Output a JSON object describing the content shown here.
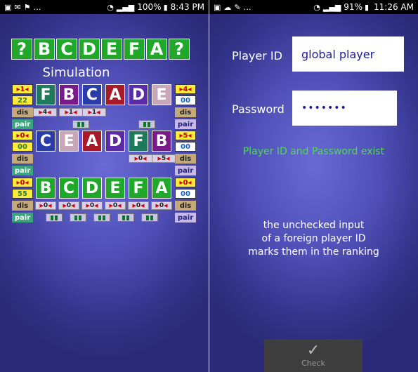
{
  "left": {
    "status": {
      "time": "8:43 PM",
      "battery": "100%"
    },
    "title_tiles": [
      {
        "ch": "?",
        "color": "#1fa82a"
      },
      {
        "ch": "B",
        "color": "#1fa82a"
      },
      {
        "ch": "C",
        "color": "#1fa82a"
      },
      {
        "ch": "D",
        "color": "#1fa82a"
      },
      {
        "ch": "E",
        "color": "#1fa82a"
      },
      {
        "ch": "F",
        "color": "#1fa82a"
      },
      {
        "ch": "A",
        "color": "#1fa82a"
      },
      {
        "ch": "?",
        "color": "#1fa82a"
      }
    ],
    "simulation_label": "Simulation",
    "blocks": [
      {
        "left_badge_top": "1",
        "left_badge_bottom": "22",
        "right_badge_top": "4",
        "right_badge_bottom": "00",
        "tiles": [
          {
            "ch": "F",
            "color": "#1e7a5a"
          },
          {
            "ch": "B",
            "color": "#7a1a8a"
          },
          {
            "ch": "C",
            "color": "#2a3ca8"
          },
          {
            "ch": "A",
            "color": "#a81a28"
          },
          {
            "ch": "D",
            "color": "#5a2aa8"
          },
          {
            "ch": "E",
            "color": "#c8a8b8"
          }
        ],
        "dis_label": "dis",
        "pair_label": "pair",
        "dis_values": [
          "4",
          "1",
          "1"
        ]
      },
      {
        "left_badge_top": "0",
        "left_badge_bottom": "00",
        "right_badge_top": "5",
        "right_badge_bottom": "00",
        "tiles": [
          {
            "ch": "C",
            "color": "#2a3ca8"
          },
          {
            "ch": "E",
            "color": "#c8a8b8"
          },
          {
            "ch": "A",
            "color": "#a81a28"
          },
          {
            "ch": "D",
            "color": "#5a2aa8"
          },
          {
            "ch": "F",
            "color": "#1e7a5a"
          },
          {
            "ch": "B",
            "color": "#7a1a8a"
          }
        ],
        "dis_label": "dis",
        "pair_label": "pair",
        "dis_values": [
          "0",
          "5"
        ]
      },
      {
        "left_badge_top": "0",
        "left_badge_bottom": "55",
        "right_badge_top": "0",
        "right_badge_bottom": "00",
        "tiles": [
          {
            "ch": "B",
            "color": "#1fa82a"
          },
          {
            "ch": "C",
            "color": "#1fa82a"
          },
          {
            "ch": "D",
            "color": "#1fa82a"
          },
          {
            "ch": "E",
            "color": "#1fa82a"
          },
          {
            "ch": "F",
            "color": "#1fa82a"
          },
          {
            "ch": "A",
            "color": "#1fa82a"
          }
        ],
        "dis_label": "dis",
        "pair_label": "pair",
        "dis_values": [
          "0",
          "0",
          "0",
          "0",
          "0",
          "0"
        ]
      }
    ]
  },
  "right": {
    "status": {
      "time": "11:26 AM",
      "battery": "91%"
    },
    "player_id_label": "Player ID",
    "player_id_value": "global player",
    "password_label": "Password",
    "password_value": "•••••••",
    "success_message": "Player ID and Password exist",
    "note_lines": [
      "the unchecked input",
      "of a foreign player ID",
      "marks them in the ranking"
    ],
    "check_label": "Check"
  }
}
